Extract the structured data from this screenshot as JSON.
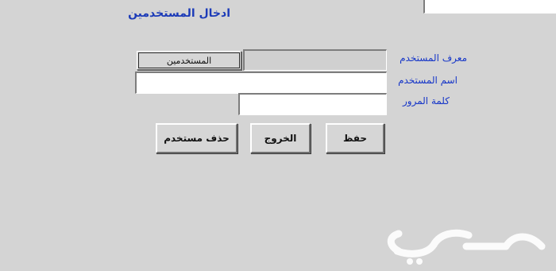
{
  "form": {
    "title": "ادخال المستخدمين",
    "labels": {
      "user_id": "معرف المستخدم",
      "user_name": "اسم المستخدم",
      "password": "كلمة المرور"
    },
    "fields": {
      "top_partial_value": "",
      "user_id_value": "",
      "user_name_value": "",
      "password_value": ""
    },
    "users_button_label": "المستخدمين"
  },
  "actions": {
    "save_label": "حفظ",
    "exit_label": "الخروج",
    "delete_user_label": "حذف مستخدم"
  },
  "watermark": {
    "text": "حراج"
  }
}
